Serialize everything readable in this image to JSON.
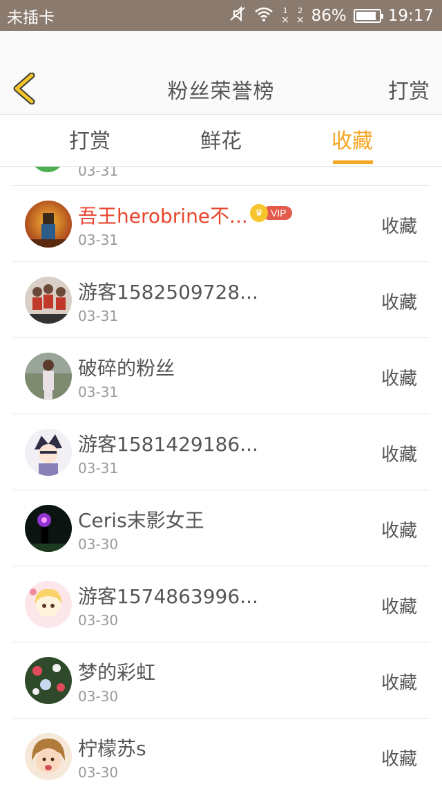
{
  "status_bar": {
    "carrier": "未插卡",
    "sim1": "1",
    "sim2": "2",
    "sim_x": "×",
    "battery_percent": "86%",
    "battery_level": 0.86,
    "time": "19:17"
  },
  "header": {
    "title": "粉丝荣誉榜",
    "action": "打赏"
  },
  "tabs": [
    {
      "label": "打赏"
    },
    {
      "label": "鲜花"
    },
    {
      "label": "收藏"
    }
  ],
  "active_tab": 2,
  "colors": {
    "accent": "#f5a623",
    "vip_name": "#e8452c",
    "status_bar_bg": "#8b7b6f"
  },
  "partial_row": {
    "date": "03-31"
  },
  "rows": [
    {
      "name": "吾王herobrine不...",
      "date": "03-31",
      "action": "收藏",
      "vip": true,
      "vip_label": "VIP"
    },
    {
      "name": "游客1582509728...",
      "date": "03-31",
      "action": "收藏"
    },
    {
      "name": "破碎的粉丝",
      "date": "03-31",
      "action": "收藏"
    },
    {
      "name": "游客1581429186...",
      "date": "03-31",
      "action": "收藏"
    },
    {
      "name": "Ceris末影女王",
      "date": "03-30",
      "action": "收藏"
    },
    {
      "name": "游客1574863996...",
      "date": "03-30",
      "action": "收藏"
    },
    {
      "name": "梦的彩虹",
      "date": "03-30",
      "action": "收藏"
    },
    {
      "name": "柠檬苏s",
      "date": "03-30",
      "action": "收藏"
    }
  ]
}
